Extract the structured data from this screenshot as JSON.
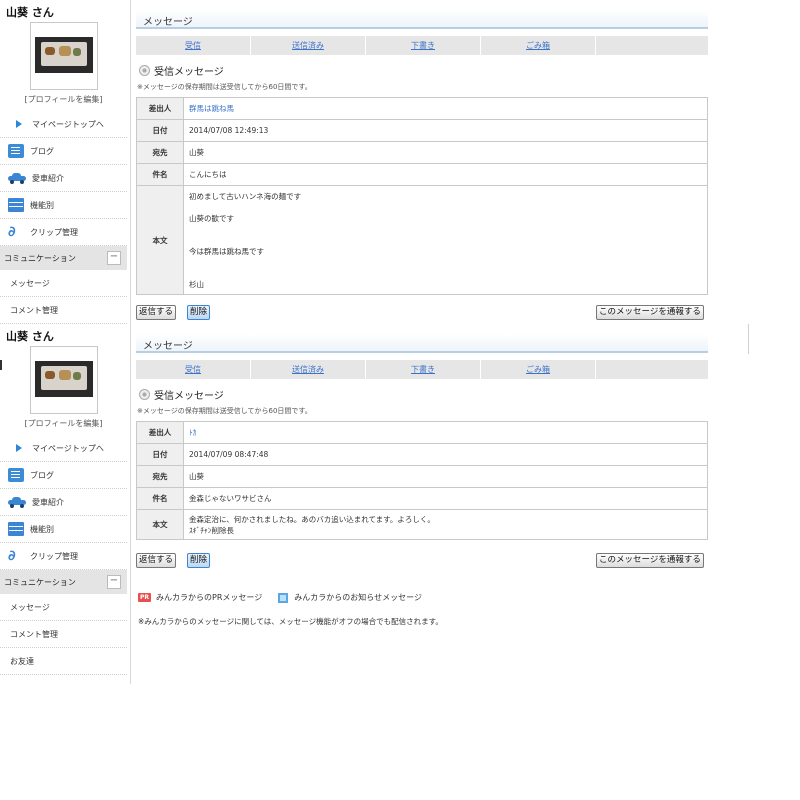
{
  "panels": [
    {
      "user": {
        "name": "山葵 さん",
        "profile_edit": "[プロフィールを編集]"
      },
      "menu": {
        "items": [
          {
            "label": "マイページトップへ",
            "icon": "triangle-right-icon"
          },
          {
            "label": "ブログ",
            "icon": "blog-icon"
          },
          {
            "label": "愛車紹介",
            "icon": "car-icon"
          },
          {
            "label": "機能別",
            "icon": "list-icon"
          },
          {
            "label": "クリップ管理",
            "icon": "clip-icon"
          }
        ],
        "section": "コミュニケーション",
        "sub_items": [
          "メッセージ",
          "コメント管理"
        ]
      },
      "header": "メッセージ",
      "tabs": [
        "受信",
        "送信済み",
        "下書き",
        "ごみ箱"
      ],
      "section_title": "受信メッセージ",
      "note": "※メッセージの保存期間は送受信してから60日間です。",
      "labels": {
        "sender": "差出人",
        "date": "日付",
        "to": "宛先",
        "subject": "件名",
        "body": "本文"
      },
      "message": {
        "sender": "群馬は跳ね馬",
        "date": "2014/07/08 12:49:13",
        "to": "山葵",
        "subject": "こんにちは",
        "body_lines": [
          "初めまして古いハンネ海の麺です",
          "",
          "山葵の歓です",
          "",
          "",
          "今は群馬は跳ね馬です",
          "",
          "",
          "杉山"
        ]
      },
      "buttons": {
        "reply": "返信する",
        "delete": "削除",
        "report": "このメッセージを通報する"
      }
    },
    {
      "user": {
        "name": "山葵 さん",
        "profile_edit": "[プロフィールを編集]"
      },
      "menu": {
        "items": [
          {
            "label": "マイページトップへ",
            "icon": "triangle-right-icon"
          },
          {
            "label": "ブログ",
            "icon": "blog-icon"
          },
          {
            "label": "愛車紹介",
            "icon": "car-icon"
          },
          {
            "label": "機能別",
            "icon": "list-icon"
          },
          {
            "label": "クリップ管理",
            "icon": "clip-icon"
          }
        ],
        "section": "コミュニケーション",
        "sub_items": [
          "メッセージ",
          "コメント管理",
          "お友達"
        ]
      },
      "header": "メッセージ",
      "tabs": [
        "受信",
        "送信済み",
        "下書き",
        "ごみ箱"
      ],
      "section_title": "受信メッセージ",
      "note": "※メッセージの保存期間は送受信してから60日間です。",
      "labels": {
        "sender": "差出人",
        "date": "日付",
        "to": "宛先",
        "subject": "件名",
        "body": "本文"
      },
      "message": {
        "sender": "ﾄｶ",
        "date": "2014/07/09 08:47:48",
        "to": "山葵",
        "subject": "金森じゃないワサビさん",
        "body_lines": [
          "金森定治に、何かされましたね。あのバカ追い込まれてます。よろしく。",
          "ｽｷﾞﾁｬﾝ削除長"
        ]
      },
      "buttons": {
        "reply": "返信する",
        "delete": "削除",
        "report": "このメッセージを通報する"
      },
      "footer": {
        "pr_badge": "PR",
        "pr_text": "みんカラからのPRメッセージ",
        "info_text": "みんカラからのお知らせメッセージ",
        "footnote": "※みんカラからのメッセージに関しては、メッセージ機能がオフの場合でも配信されます。"
      }
    }
  ]
}
